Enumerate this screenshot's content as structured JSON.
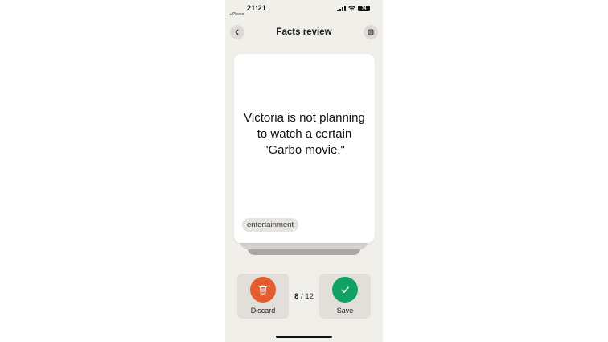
{
  "status_bar": {
    "time": "21:21",
    "back_app": "◂ Phone",
    "battery": "74"
  },
  "nav": {
    "title": "Facts review",
    "back_icon": "chevron-left-icon",
    "menu_icon": "list-icon"
  },
  "card": {
    "fact": "Victoria is not planning to watch a certain \"Garbo movie.\"",
    "tag": "entertainment"
  },
  "actions": {
    "discard_label": "Discard",
    "discard_color": "#e35b2f",
    "save_label": "Save",
    "save_color": "#12a164"
  },
  "progress": {
    "current": "8",
    "separator": "/",
    "total": "12"
  }
}
